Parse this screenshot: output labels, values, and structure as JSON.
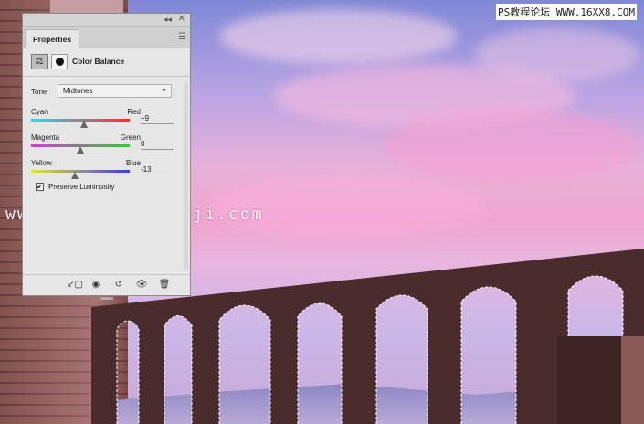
{
  "panel": {
    "tab_label": "Properties",
    "adjustment_title": "Color Balance",
    "tone": {
      "label": "Tone:",
      "selected": "Midtones"
    },
    "sliders": [
      {
        "left": "Cyan",
        "right": "Red",
        "value": "+9",
        "level": 0.54
      },
      {
        "left": "Magenta",
        "right": "Green",
        "value": "0",
        "level": 0.5
      },
      {
        "left": "Yellow",
        "right": "Blue",
        "value": "-13",
        "level": 0.44
      }
    ],
    "preserve_luminosity": {
      "label": "Preserve Luminosity",
      "checked": true
    }
  },
  "watermarks": {
    "top": "PS教程论坛 WWW.16XX8.COM",
    "middle": "www.hsoviejianbeji.com"
  },
  "icons": {
    "adjustment": "balance-scale-icon",
    "mask": "layer-mask-icon",
    "toolbar": [
      "clip-to-layer-icon",
      "view-previous-icon",
      "reset-icon",
      "visibility-eye-icon",
      "trash-icon"
    ]
  }
}
